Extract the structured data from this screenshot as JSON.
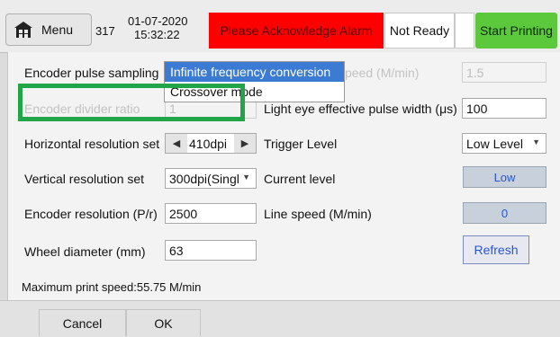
{
  "header": {
    "menu_label": "Menu",
    "menu_icon": "home-icon",
    "count": "317",
    "date": "01-07-2020",
    "time": "15:32:22",
    "alarm_text": "Please Acknowledge Alarm",
    "status_text": "Not Ready",
    "start_label": "Start Printing",
    "colors": {
      "alarm": "#ff0000",
      "start": "#5cc83c",
      "highlight": "#21a548",
      "link": "#2855d0"
    }
  },
  "form": {
    "encoder_sampling": {
      "label": "Encoder pulse sampling",
      "options": [
        "Infinite frequency conversion",
        "Crossover mode"
      ],
      "selected": "Infinite frequency conversion"
    },
    "encoder_divider": {
      "label": "Encoder divider ratio",
      "value": "1"
    },
    "right_top": {
      "label": "peed (M/min)",
      "value": "1.5"
    },
    "light_eye": {
      "label": "Light eye effective pulse width (μs)",
      "value": "100"
    },
    "horizontal": {
      "label": "Horizontal resolution set",
      "value": "410dpi"
    },
    "trigger": {
      "label": "Trigger Level",
      "value": "Low Level"
    },
    "vertical": {
      "label": "Vertical resolution set",
      "value": "300dpi(Single"
    },
    "current": {
      "label": "Current level",
      "value": "Low"
    },
    "encoder_res": {
      "label": "Encoder resolution (P/r)",
      "value": "2500"
    },
    "line_speed": {
      "label": "Line speed (M/min)",
      "value": "0"
    },
    "wheel": {
      "label": "Wheel diameter (mm)",
      "value": "63"
    },
    "refresh_label": "Refresh",
    "max_speed_text": "Maximum print speed:55.75 M/min"
  },
  "footer": {
    "cancel_label": "Cancel",
    "ok_label": "OK"
  }
}
